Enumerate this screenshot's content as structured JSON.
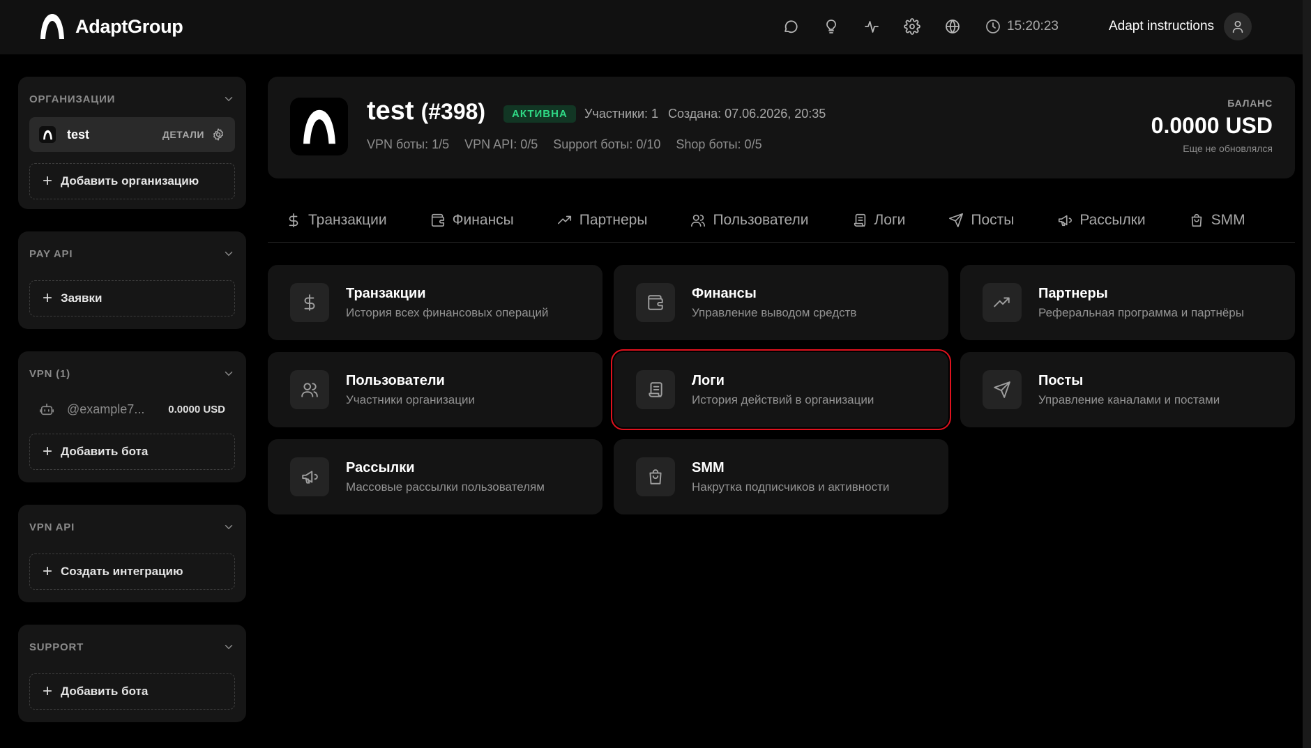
{
  "brand": {
    "name": "AdaptGroup"
  },
  "header": {
    "icons": [
      "chat-icon",
      "lightbulb-icon",
      "activity-icon",
      "settings-icon",
      "globe-icon"
    ],
    "time": "15:20:23",
    "user_name": "Adapt instructions"
  },
  "sidebar": {
    "organizations": {
      "title": "ОРГАНИЗАЦИИ",
      "item_name": "test",
      "item_details": "ДЕТАЛИ",
      "add_label": "Добавить организацию"
    },
    "pay_api": {
      "title": "PAY API",
      "add_label": "Заявки"
    },
    "vpn": {
      "title": "VPN (1)",
      "bot_name": "@example7...",
      "bot_balance": "0.0000 USD",
      "add_label": "Добавить бота"
    },
    "vpn_api": {
      "title": "VPN API",
      "add_label": "Создать интеграцию"
    },
    "support": {
      "title": "SUPPORT",
      "add_label": "Добавить бота"
    }
  },
  "org": {
    "name": "test",
    "id": "(#398)",
    "status": "АКТИВНА",
    "members": "Участники: 1",
    "created": "Создана: 07.06.2026, 20:35",
    "vpn_bots": "VPN боты: 1/5",
    "vpn_api": "VPN API: 0/5",
    "support_bots": "Support боты: 0/10",
    "shop_bots": "Shop боты: 0/5",
    "balance_label": "БАЛАНС",
    "balance_value": "0.0000 USD",
    "balance_note": "Еще не обновлялся"
  },
  "tabs": [
    {
      "label": "Транзакции",
      "icon": "dollar-icon"
    },
    {
      "label": "Финансы",
      "icon": "wallet-icon"
    },
    {
      "label": "Партнеры",
      "icon": "trending-up-icon"
    },
    {
      "label": "Пользователи",
      "icon": "users-icon"
    },
    {
      "label": "Логи",
      "icon": "scroll-icon"
    },
    {
      "label": "Посты",
      "icon": "send-icon"
    },
    {
      "label": "Рассылки",
      "icon": "megaphone-icon"
    },
    {
      "label": "SMM",
      "icon": "shopping-bag-icon"
    }
  ],
  "cards": [
    {
      "title": "Транзакции",
      "subtitle": "История всех финансовых операций",
      "icon": "dollar-icon"
    },
    {
      "title": "Финансы",
      "subtitle": "Управление выводом средств",
      "icon": "wallet-icon"
    },
    {
      "title": "Партнеры",
      "subtitle": "Реферальная программа и партнёры",
      "icon": "trending-up-icon"
    },
    {
      "title": "Пользователи",
      "subtitle": "Участники организации",
      "icon": "users-icon"
    },
    {
      "title": "Логи",
      "subtitle": "История действий в организации",
      "icon": "scroll-icon",
      "highlighted": true
    },
    {
      "title": "Посты",
      "subtitle": "Управление каналами и постами",
      "icon": "send-icon"
    },
    {
      "title": "Рассылки",
      "subtitle": "Массовые рассылки пользователям",
      "icon": "megaphone-icon"
    },
    {
      "title": "SMM",
      "subtitle": "Накрутка подписчиков и активности",
      "icon": "shopping-bag-icon"
    }
  ],
  "colors": {
    "background": "#000000",
    "panel": "#141414",
    "status_green": "#2fd985",
    "highlight_red": "#e0121e"
  }
}
